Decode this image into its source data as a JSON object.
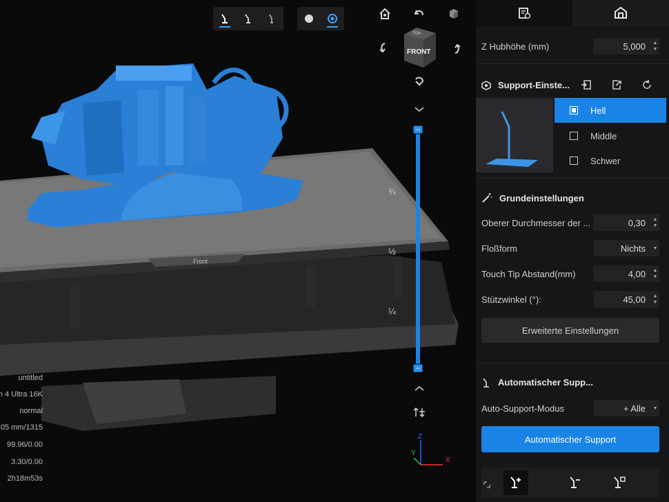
{
  "viewport": {
    "scale_labels": [
      "¾",
      "½",
      "¼"
    ],
    "plate_label": "Front",
    "view_cube_label": "FRONT",
    "view_cube_top_label": "TOP",
    "info": [
      "untitled",
      "n 4 Ultra 16K",
      "normal",
      "05 mm/1315",
      "99.96/0.00",
      "3.30/0.00",
      "2h18m53s"
    ],
    "axes": {
      "x": "X",
      "y": "Y",
      "z": "Z"
    }
  },
  "toolbar_icons": [
    "support-tool-1-icon",
    "support-tool-2-icon",
    "support-tool-3-icon",
    "solid-view-icon",
    "xray-view-icon"
  ],
  "panel": {
    "tabs": [
      "print-settings-icon",
      "support-settings-icon"
    ],
    "z_lift": {
      "label": "Z Hubhöhe (mm)",
      "value": "5,000"
    },
    "support_settings": {
      "title": "Support-Einste...",
      "presets": [
        "Hell",
        "Middle",
        "Schwer"
      ],
      "selected": "Hell"
    },
    "basic": {
      "title": "Grundeinstellungen",
      "rows": [
        {
          "label": "Oberer Durchmesser der ...",
          "value": "0,30"
        },
        {
          "label": "Floßform",
          "value": "Nichts"
        },
        {
          "label": "Touch Tip Abstand(mm)",
          "value": "4,00"
        },
        {
          "label": "Stützwinkel (°):",
          "value": "45,00"
        }
      ],
      "advanced_button": "Erweiterte Einstellungen"
    },
    "auto_support": {
      "title": "Automatischer Supp...",
      "mode_label": "Auto-Support-Modus",
      "mode_value": "+ Alle",
      "button": "Automatischer Support"
    }
  },
  "colors": {
    "accent": "#1a84e6",
    "model": "#2a7fd6",
    "panel": "#161618"
  }
}
